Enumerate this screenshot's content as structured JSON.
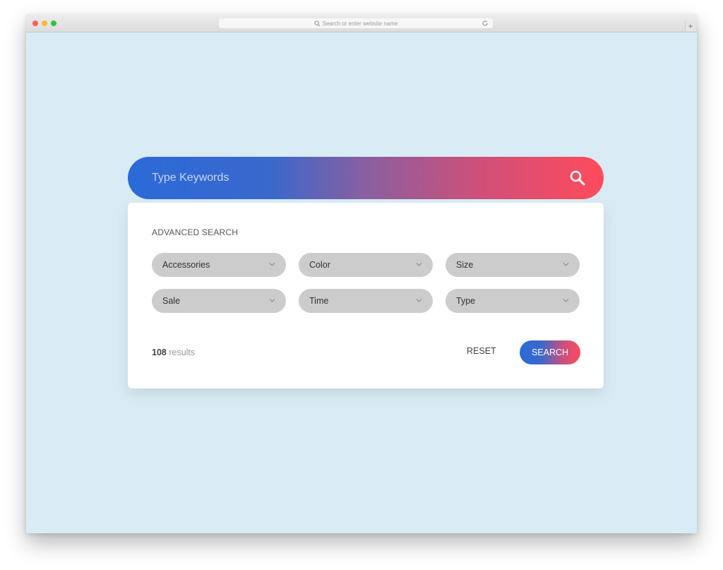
{
  "browser": {
    "url_placeholder": "Search or enter website name",
    "new_tab_label": "+"
  },
  "search": {
    "placeholder": "Type Keywords",
    "icon": "search-icon",
    "gradient_start": "#2b6ad8",
    "gradient_end": "#ff4b5c"
  },
  "advanced": {
    "title": "ADVANCED SEARCH",
    "filters": [
      {
        "label": "Accessories"
      },
      {
        "label": "Color"
      },
      {
        "label": "Size"
      },
      {
        "label": "Sale"
      },
      {
        "label": "Time"
      },
      {
        "label": "Type"
      }
    ],
    "results_count": "108",
    "results_label": "results",
    "reset_label": "RESET",
    "search_label": "SEARCH"
  }
}
